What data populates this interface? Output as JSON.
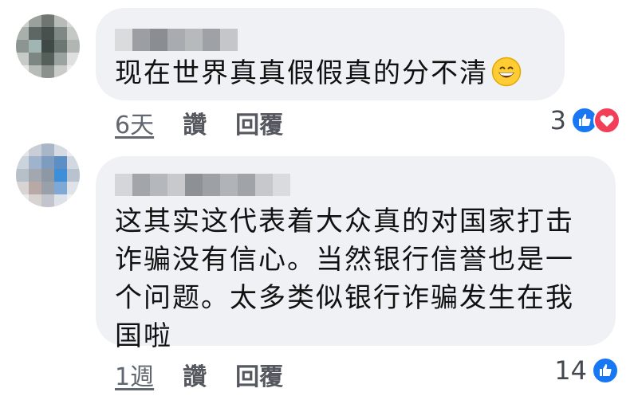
{
  "colors": {
    "bubble_bg": "#eff1f4",
    "text": "#111111",
    "meta_text": "#606770",
    "like_blue": "#1877f2",
    "love_red": "#f33e58"
  },
  "comments": [
    {
      "text": "现在世界真真假假真的分不清",
      "emoji": "grinning-face-emoji",
      "time": "6天",
      "like_label": "讚",
      "reply_label": "回覆",
      "reaction_count": "3",
      "reaction_icons": [
        "like-reaction-icon",
        "love-reaction-icon"
      ]
    },
    {
      "text": "这其实这代表着大众真的对国家打击\n诈骗没有信心。当然银行信誉也是一\n个问题。太多类似银行诈骗发生在我\n国啦",
      "time": "1週",
      "like_label": "讚",
      "reply_label": "回覆",
      "reaction_count": "14",
      "reaction_icons": [
        "like-reaction-icon"
      ]
    }
  ]
}
